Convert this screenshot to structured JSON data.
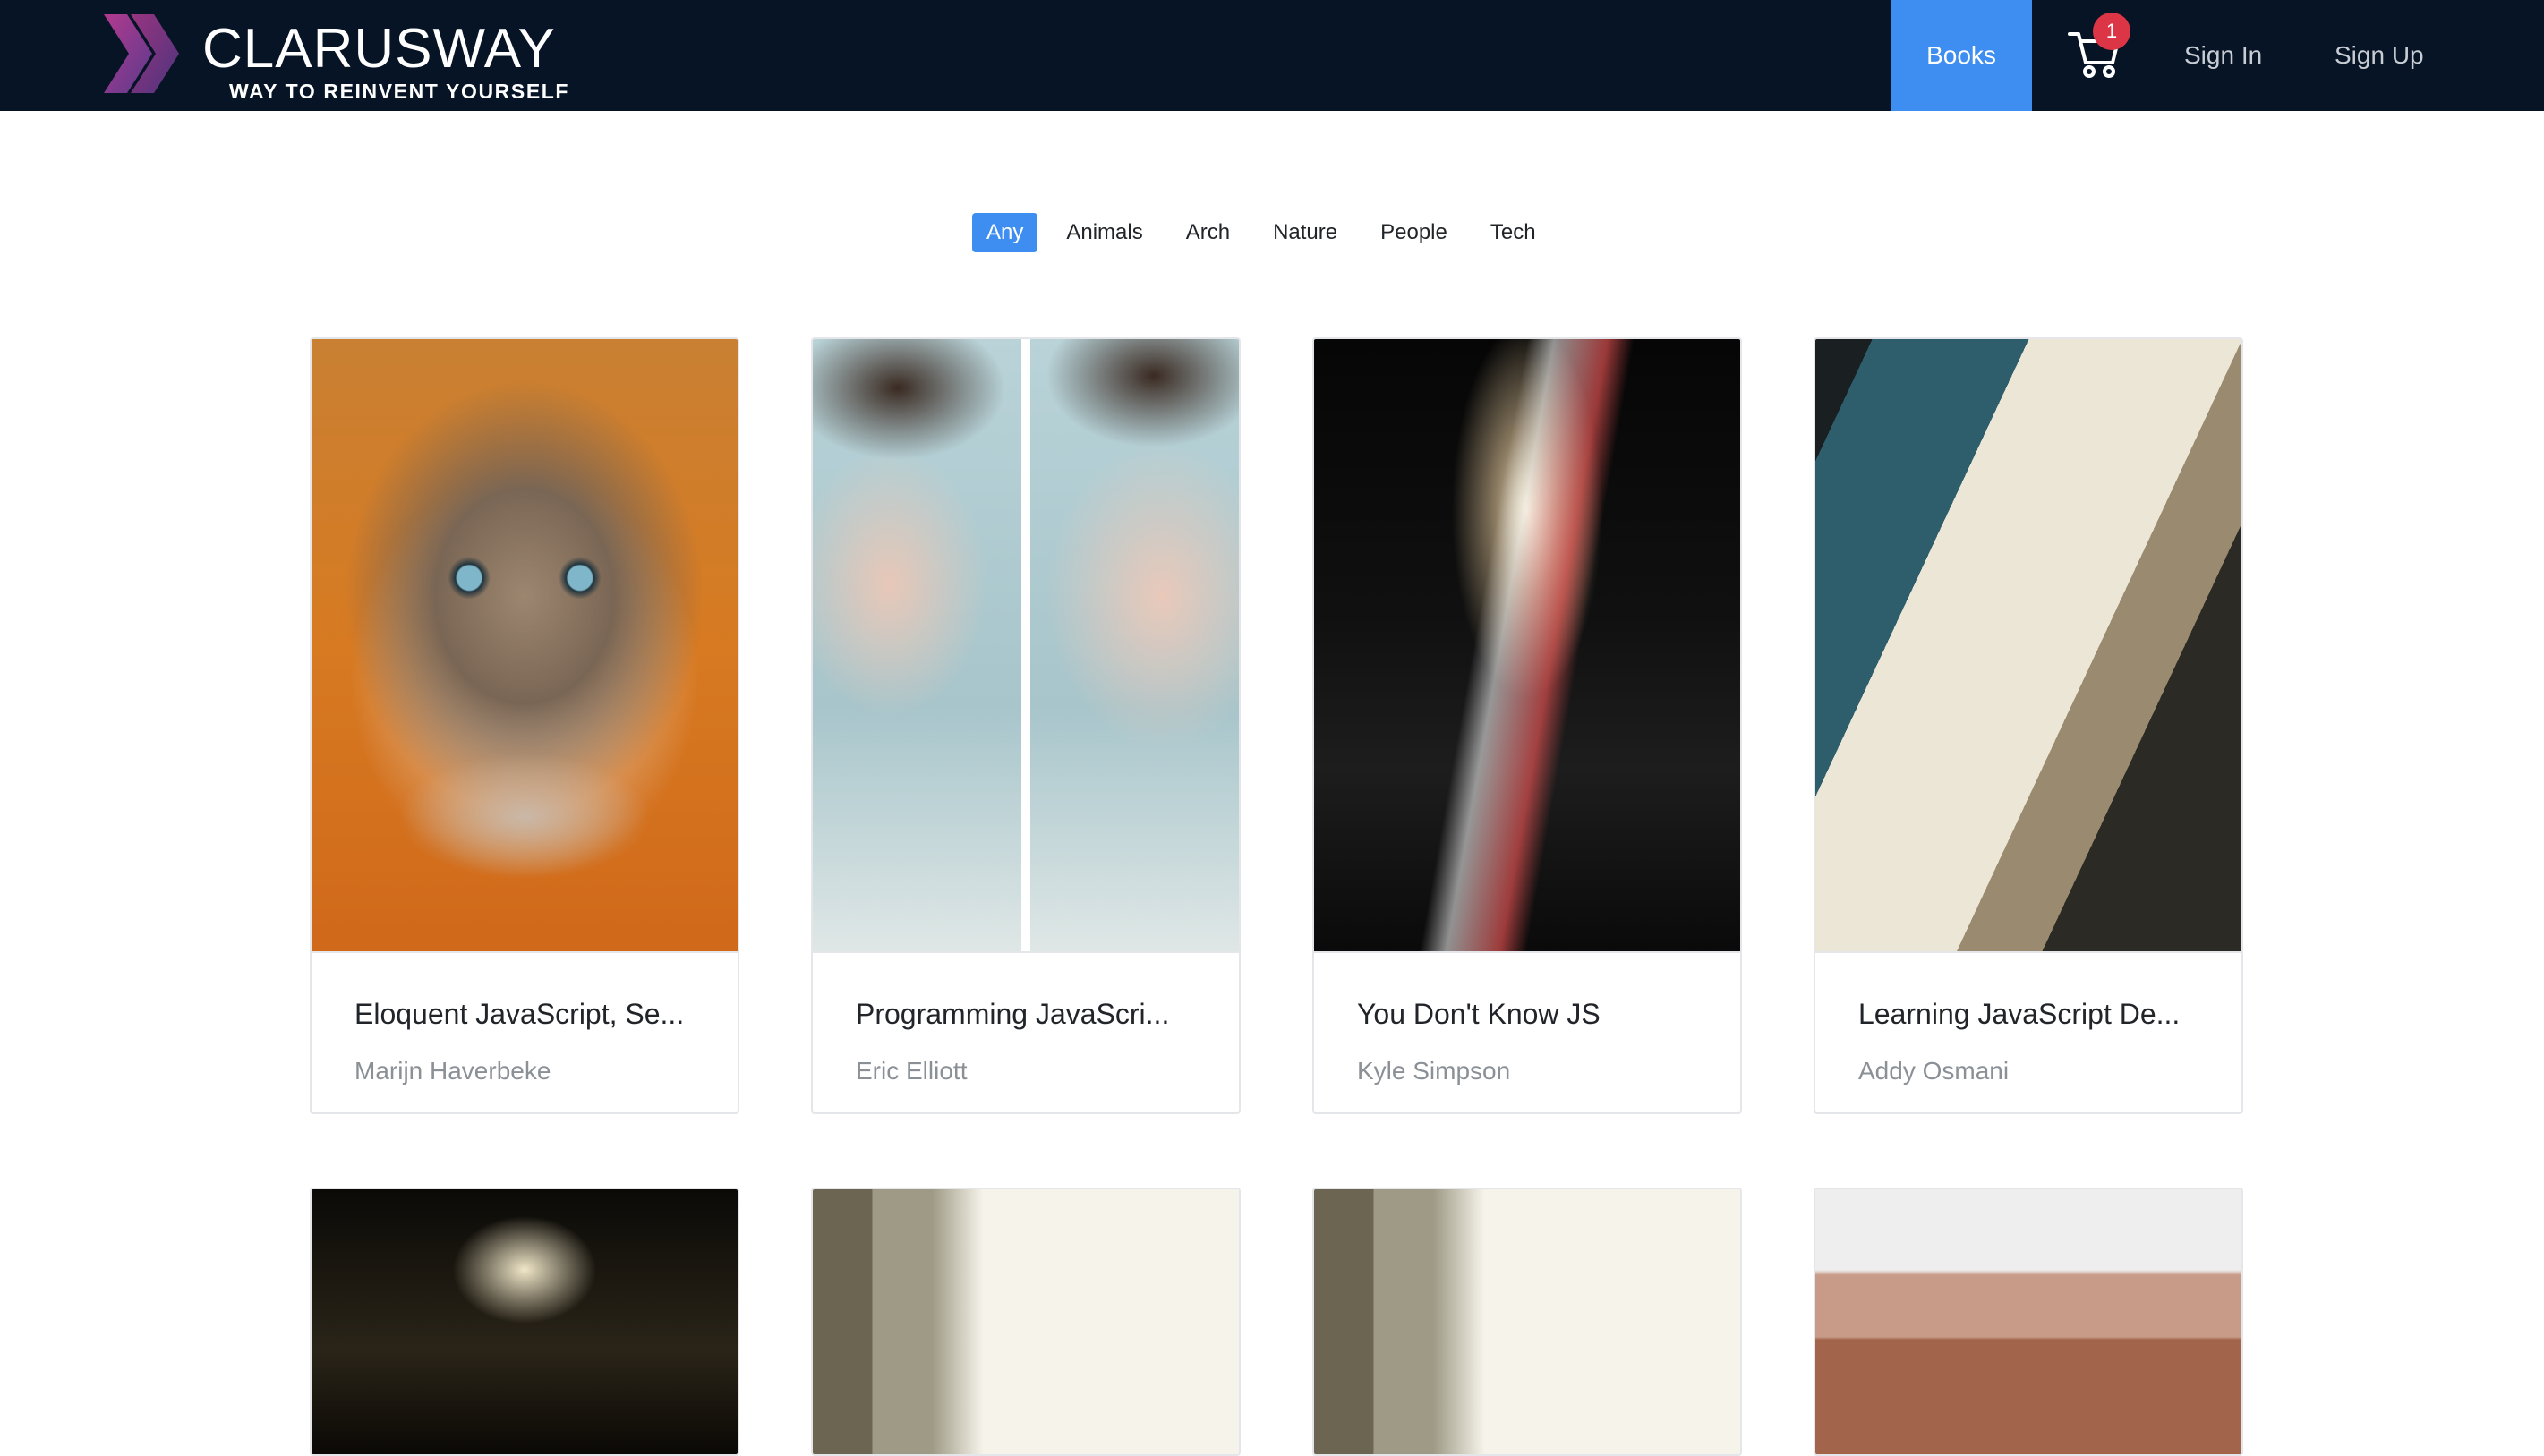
{
  "brand": {
    "title": "CLARUSWAY",
    "tagline": "WAY TO REINVENT YOURSELF"
  },
  "nav": {
    "books_label": "Books",
    "cart_count": "1",
    "signin_label": "Sign In",
    "signup_label": "Sign Up"
  },
  "filters": [
    "Any",
    "Animals",
    "Arch",
    "Nature",
    "People",
    "Tech"
  ],
  "active_filter": "Any",
  "books": [
    {
      "title": "Eloquent JavaScript, Se...",
      "author": "Marijn Haverbeke",
      "image": "cat-photo"
    },
    {
      "title": "Programming JavaScri...",
      "author": "Eric Elliott",
      "image": "mirrored-woman-photo"
    },
    {
      "title": "You Don't Know JS",
      "author": "Kyle Simpson",
      "image": "night-bridge-photo"
    },
    {
      "title": "Learning JavaScript De...",
      "author": "Addy Osmani",
      "image": "laptop-welcome-photo"
    }
  ],
  "books_row2": [
    {
      "image": "night-bridge-photo"
    },
    {
      "image": "blurred-window-photo"
    },
    {
      "image": "blurred-window-photo"
    },
    {
      "image": "red-rock-photo"
    }
  ],
  "colors": {
    "navbar_bg": "#061426",
    "accent": "#3d8ef0",
    "badge": "#dc3545"
  }
}
